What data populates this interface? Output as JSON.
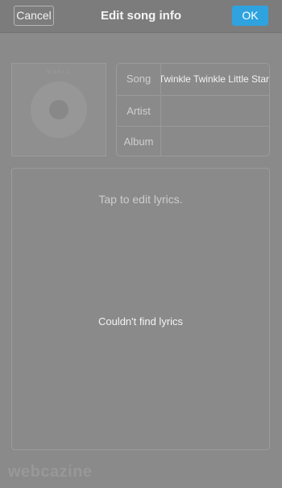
{
  "header": {
    "cancel_label": "Cancel",
    "title": "Edit song info",
    "ok_label": "OK",
    "accent_color": "#2ea3df"
  },
  "album_art": {
    "text": "MUSIC",
    "icon": "disc-icon"
  },
  "fields": [
    {
      "label": "Song",
      "value": "Twinkle Twinkle Little Star"
    },
    {
      "label": "Artist",
      "value": ""
    },
    {
      "label": "Album",
      "value": ""
    }
  ],
  "lyrics": {
    "hint": "Tap to edit lyrics.",
    "empty_message": "Couldn't find lyrics"
  },
  "watermark": "webcazine"
}
